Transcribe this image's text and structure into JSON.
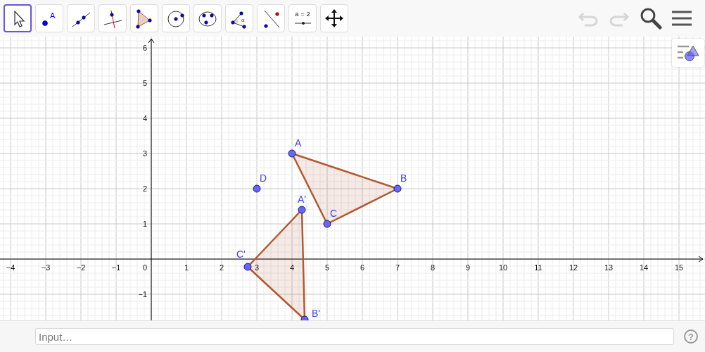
{
  "toolbar": {
    "tools": [
      {
        "kind": "move",
        "selected": true
      },
      {
        "kind": "point",
        "label": "A",
        "selected": false
      },
      {
        "kind": "line",
        "selected": false
      },
      {
        "kind": "perpendicular",
        "selected": false
      },
      {
        "kind": "polygon",
        "selected": false
      },
      {
        "kind": "circle",
        "selected": false
      },
      {
        "kind": "conic",
        "selected": false
      },
      {
        "kind": "angle",
        "label": "α",
        "selected": false
      },
      {
        "kind": "reflect",
        "selected": false
      },
      {
        "kind": "slider",
        "label": "a = 2",
        "selected": false
      },
      {
        "kind": "move_view",
        "selected": false
      }
    ],
    "undo": {
      "disabled": true
    },
    "redo": {
      "disabled": true
    }
  },
  "graphics": {
    "x_axis": {
      "ticks": [
        "−4",
        "−3",
        "−2",
        "−1",
        "0",
        "1",
        "2",
        "3",
        "4",
        "5",
        "6",
        "7",
        "8",
        "9",
        "10",
        "11",
        "12",
        "13",
        "14",
        "15"
      ]
    },
    "y_axis": {
      "ticks": [
        "6",
        "5",
        "4",
        "3",
        "2",
        "1",
        "−1"
      ]
    },
    "points": [
      {
        "label": "A"
      },
      {
        "label": "B"
      },
      {
        "label": "C"
      },
      {
        "label": "D"
      },
      {
        "label": "A'"
      },
      {
        "label": "B'"
      },
      {
        "label": "C'"
      }
    ]
  },
  "input_bar": {
    "placeholder": "Input…",
    "help": "?"
  }
}
